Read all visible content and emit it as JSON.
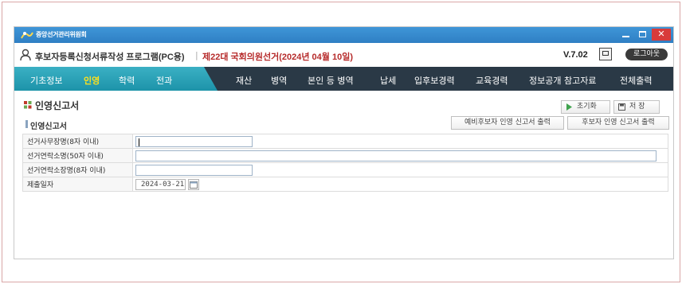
{
  "window": {
    "app_name": "중앙선거관리위원회",
    "minimize_label": "—",
    "close_label": "✕"
  },
  "header": {
    "program_title": "후보자등록신청서류작성 프로그램(PC용)",
    "divider": "|",
    "election_title": "제22대 국회의원선거(2024년 04월 10일)",
    "version": "V.7.02",
    "logout_label": "로그아웃"
  },
  "nav": {
    "left_items": [
      {
        "label": "기초정보",
        "active": false
      },
      {
        "label": "인영",
        "active": true
      },
      {
        "label": "학력",
        "active": false
      },
      {
        "label": "전과",
        "active": false
      }
    ],
    "right_items": [
      {
        "label": "재산"
      },
      {
        "label": "병역"
      },
      {
        "label": "본인 등 병역"
      },
      {
        "label": "납세"
      },
      {
        "label": "입후보경력"
      },
      {
        "label": "교육경력"
      },
      {
        "label": "정보공개 참고자료"
      },
      {
        "label": "전체출력"
      }
    ]
  },
  "page": {
    "title": "인영신고서",
    "reset_label": "초기화",
    "save_label": "저 장",
    "section_title": "인영신고서",
    "print_pre_candidate_label": "예비후보자 인영 신고서 출력",
    "print_candidate_label": "후보자 인영 신고서 출력"
  },
  "form": {
    "rows": [
      {
        "label": "선거사무장명(8자 이내)",
        "value": ""
      },
      {
        "label": "선거연락소명(50자 이내)",
        "value": ""
      },
      {
        "label": "선거연락소장명(8자 이내)",
        "value": ""
      },
      {
        "label": "제출일자",
        "value": "2024-03-21"
      }
    ]
  },
  "colors": {
    "titlebar": "#2f7fc4",
    "nav_dark": "#2a3946",
    "nav_teal": "#1d93a9",
    "nav_active": "#ffe11c",
    "election_title": "#b62a2a"
  },
  "icons": {
    "logo": "nec-logo-icon",
    "user": "user-outline-icon",
    "monitor": "monitor-icon",
    "page_title": "grid-squares-icon",
    "reset": "play-arrow-icon",
    "save": "floppy-disk-icon",
    "calendar": "calendar-icon"
  }
}
